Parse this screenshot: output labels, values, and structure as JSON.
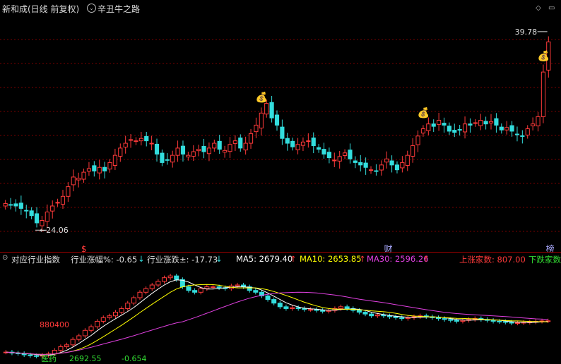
{
  "header": {
    "title": "新和成(日线 前复权)",
    "indicator": "辛丑牛之路",
    "collapse_icon": "chevron-down-icon"
  },
  "main_chart": {
    "high_label": "39.78",
    "low_label": "24.06",
    "markers": [
      {
        "type": "money-bag-icon",
        "glyph": "💰",
        "index": 49
      },
      {
        "type": "money-bag-icon",
        "glyph": "💰",
        "index": 80
      },
      {
        "type": "money-bag-icon",
        "glyph": "💰",
        "index": 103
      }
    ],
    "bottom_tags": [
      {
        "label": "$",
        "index": 15
      },
      {
        "label": "财",
        "index": 73
      },
      {
        "label": "榜",
        "index": 104
      }
    ]
  },
  "sub_header": {
    "name": "对应行业指数",
    "pct_label": "行业涨幅%: -0.65",
    "pct_arrow": "↓",
    "chg_label": "行业涨跌±: -17.73",
    "chg_arrow": "↓",
    "ma5": "MA5: 2679.40",
    "ma5_arrow": "↑",
    "ma10": "MA10: 2653.85",
    "ma10_arrow": "↑",
    "ma30": "MA30: 2596.26",
    "ma30_arrow": "↑",
    "up_count": "上涨家数: 807.00",
    "down_count": "下跌家数",
    "volume_label": "880400",
    "sector_label": "医药",
    "index_value": "2692.55",
    "index_change": "-0.654"
  },
  "colors": {
    "up": "#ff3a3a",
    "down": "#33dddd",
    "ma5": "#ffffff",
    "ma10": "#ffff00",
    "ma30": "#e040e0",
    "grid": "#7a0000",
    "tag": "#aaaaff"
  },
  "chart_data": [
    {
      "type": "candlestick",
      "title": "新和成(日线 前复权)",
      "ylim": [
        22,
        41
      ],
      "close": [
        26.0,
        25.9,
        25.8,
        25.6,
        25.4,
        25.0,
        24.4,
        24.6,
        25.3,
        25.8,
        26.1,
        26.6,
        27.4,
        28.2,
        28.1,
        28.6,
        28.9,
        28.7,
        29.0,
        28.7,
        29.4,
        30.0,
        30.6,
        31.0,
        31.3,
        31.2,
        31.4,
        31.2,
        31.0,
        30.1,
        29.4,
        29.6,
        30.0,
        30.6,
        30.1,
        30.0,
        30.3,
        30.5,
        30.3,
        30.6,
        31.0,
        30.5,
        30.4,
        30.9,
        31.2,
        30.6,
        31.0,
        31.8,
        32.5,
        33.5,
        34.3,
        33.1,
        32.5,
        31.4,
        31.0,
        30.7,
        30.9,
        31.1,
        31.2,
        30.8,
        30.5,
        30.1,
        29.8,
        29.6,
        29.9,
        30.2,
        29.7,
        29.4,
        29.2,
        29.0,
        28.8,
        28.7,
        29.2,
        29.7,
        29.2,
        28.8,
        29.4,
        30.0,
        30.8,
        31.6,
        32.2,
        32.6,
        32.4,
        32.9,
        32.5,
        32.0,
        31.9,
        32.1,
        32.6,
        32.5,
        32.7,
        32.9,
        32.6,
        32.8,
        32.5,
        32.1,
        32.3,
        32.0,
        31.7,
        31.6,
        32.2,
        32.6,
        33.2,
        36.9,
        39.4
      ],
      "open_note": "open values approximated from close"
    },
    {
      "type": "candlestick",
      "title": "对应行业指数",
      "series": [
        {
          "name": "MA5",
          "last": 2679.4
        },
        {
          "name": "MA10",
          "last": 2653.85
        },
        {
          "name": "MA30",
          "last": 2596.26
        }
      ],
      "close": [
        2520,
        2515,
        2512,
        2505,
        2500,
        2498,
        2502,
        2510,
        2530,
        2550,
        2560,
        2590,
        2610,
        2640,
        2660,
        2690,
        2710,
        2720,
        2740,
        2760,
        2790,
        2820,
        2850,
        2870,
        2890,
        2910,
        2930,
        2940,
        2920,
        2880,
        2860,
        2850,
        2870,
        2880,
        2880,
        2875,
        2870,
        2885,
        2890,
        2880,
        2860,
        2850,
        2830,
        2810,
        2790,
        2770,
        2760,
        2765,
        2760,
        2755,
        2755,
        2750,
        2745,
        2750,
        2760,
        2770,
        2760,
        2750,
        2740,
        2730,
        2720,
        2725,
        2720,
        2715,
        2710,
        2705,
        2710,
        2715,
        2720,
        2715,
        2710,
        2705,
        2700,
        2695,
        2690,
        2695,
        2700,
        2705,
        2700,
        2695,
        2690,
        2688,
        2685,
        2680,
        2682,
        2684,
        2686,
        2690,
        2692,
        2692.55
      ]
    }
  ]
}
